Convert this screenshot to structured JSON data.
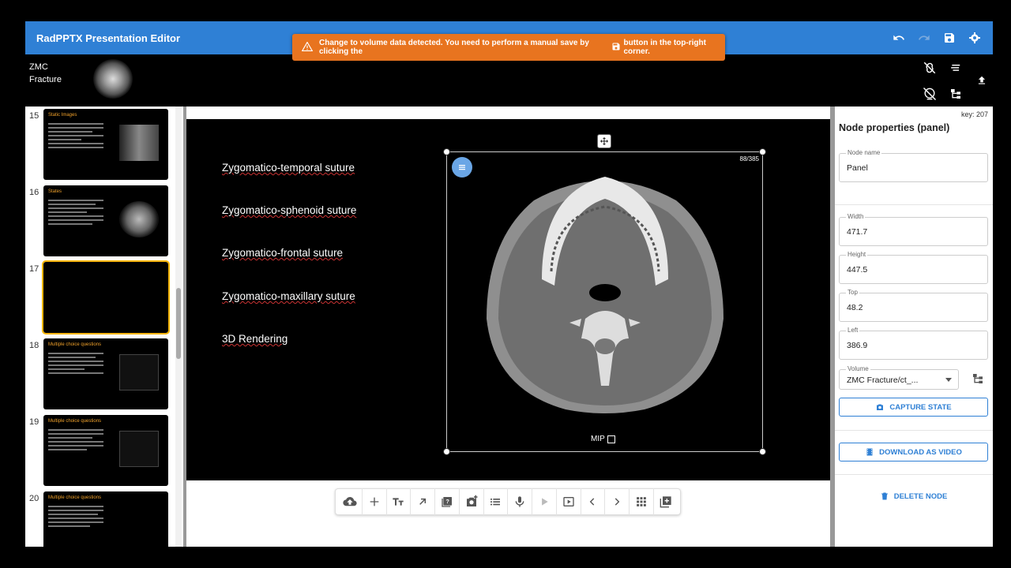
{
  "app": {
    "title": "RadPPTX Presentation Editor"
  },
  "toast": {
    "text_before": "Change to volume data detected. You need to perform a manual save by clicking the",
    "text_after": "button in the top-right corner."
  },
  "topbar": {
    "icons": [
      "undo-icon",
      "redo-icon",
      "save-icon",
      "settings-icon"
    ]
  },
  "presentation": {
    "name_line1": "ZMC",
    "name_line2": "Fracture"
  },
  "slides": [
    {
      "num": "15",
      "title": "Static Images",
      "selected": false
    },
    {
      "num": "16",
      "title": "States",
      "selected": false
    },
    {
      "num": "17",
      "title": "",
      "selected": true
    },
    {
      "num": "18",
      "title": "Multiple choice questions",
      "selected": false
    },
    {
      "num": "19",
      "title": "Multiple choice questions",
      "selected": false
    },
    {
      "num": "20",
      "title": "Multiple choice questions",
      "selected": false
    }
  ],
  "slide": {
    "bullets": [
      "Zygomatico-temporal suture",
      "Zygomatico-sphenoid suture",
      "Zygomatico-frontal suture",
      "Zygomatico-maxillary suture",
      "3D Rendering"
    ],
    "slice_counter": "88/385",
    "mip_label": "MIP"
  },
  "properties": {
    "key_label": "key: 207",
    "heading": "Node properties (panel)",
    "node_name_label": "Node name",
    "node_name": "Panel",
    "width_label": "Width",
    "width": "471.7",
    "height_label": "Height",
    "height": "447.5",
    "top_label": "Top",
    "top": "48.2",
    "left_label": "Left",
    "left": "386.9",
    "volume_label": "Volume",
    "volume": "ZMC Fracture/ct_...",
    "capture_label": "CAPTURE STATE",
    "download_label": "DOWNLOAD AS VIDEO",
    "delete_label": "DELETE NODE"
  },
  "colors": {
    "brand": "#2f80d5",
    "toast": "#e8741f",
    "selected": "#f5b400",
    "accent_title": "#f1a22b"
  }
}
